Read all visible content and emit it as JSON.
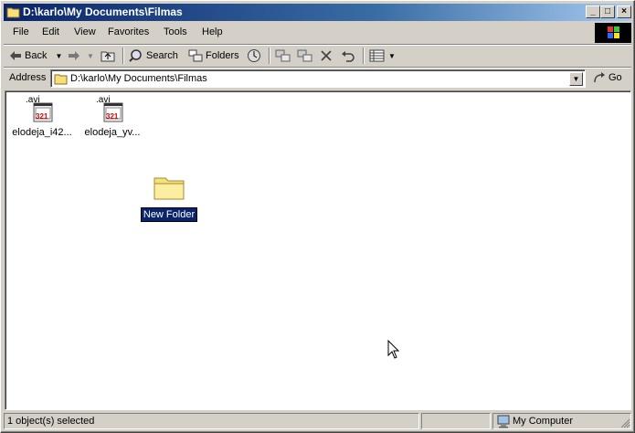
{
  "window": {
    "title": "D:\\karlo\\My Documents\\Filmas"
  },
  "titlebar_buttons": {
    "minimize": "_",
    "maximize": "□",
    "close": "×"
  },
  "menu": [
    "File",
    "Edit",
    "View",
    "Favorites",
    "Tools",
    "Help"
  ],
  "toolbar": {
    "back_label": "Back",
    "search_label": "Search",
    "folders_label": "Folders"
  },
  "address": {
    "label": "Address",
    "path": "D:\\karlo\\My Documents\\Filmas",
    "go_label": "Go"
  },
  "files": [
    {
      "ext": ".avi",
      "badge": "321",
      "name": "elodeja_i42..."
    },
    {
      "ext": ".avi",
      "badge": "321",
      "name": "elodeja_yv..."
    }
  ],
  "new_folder": {
    "name": "New Folder"
  },
  "status": {
    "selection": "1 object(s) selected",
    "zone": "My Computer"
  }
}
